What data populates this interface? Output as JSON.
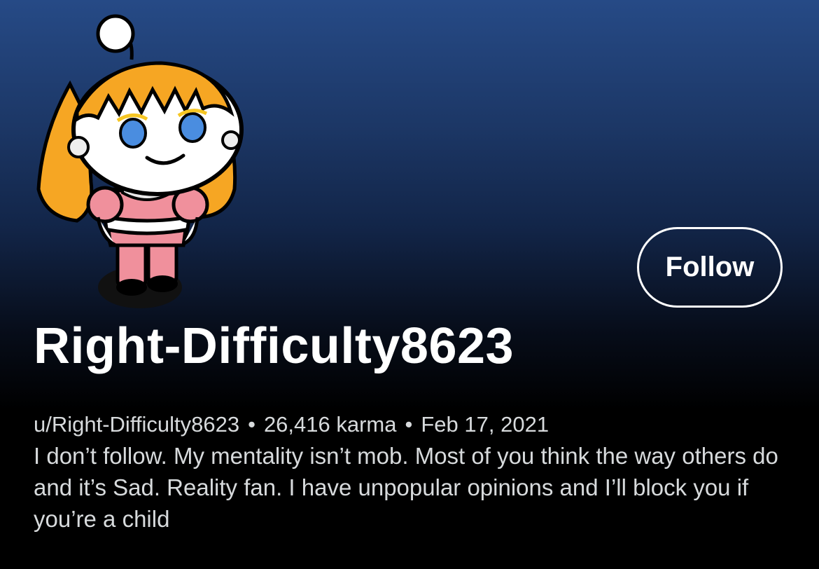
{
  "profile": {
    "display_name": "Right-Difficulty8623",
    "username": "u/Right-Difficulty8623",
    "karma": "26,416 karma",
    "cake_day": "Feb 17, 2021",
    "separator": "•",
    "bio": "I don’t follow. My mentality isn’t mob. Most of you think the way others do and it’s Sad. Reality fan. I have unpopular opinions and I’ll block you if you’re a child"
  },
  "actions": {
    "follow_label": "Follow"
  },
  "avatar": {
    "icon": "snoo-avatar-icon",
    "colors": {
      "hair": "#f6a623",
      "dress": "#f0909c",
      "eyes": "#4a8de0",
      "skin": "#ffffff",
      "outline": "#000000"
    }
  },
  "colors": {
    "header_top": "#264a86",
    "background": "#000000",
    "text_secondary": "#d7dadc"
  }
}
